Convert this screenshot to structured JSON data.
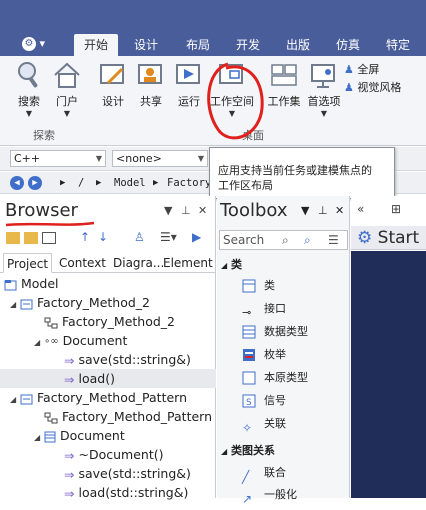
{
  "ribbon_tabs": [
    {
      "label": "开始",
      "active": true
    },
    {
      "label": "设计"
    },
    {
      "label": "布局"
    },
    {
      "label": "开发"
    },
    {
      "label": "出版"
    },
    {
      "label": "仿真"
    },
    {
      "label": "特定"
    }
  ],
  "ribbon": {
    "search": "搜索",
    "portal": "门户",
    "design": "设计",
    "share": "共享",
    "run": "运行",
    "workspace": "工作空间",
    "workset": "工作集",
    "preferences": "首选项",
    "fullscreen": "全屏",
    "visual_style": "视觉风格",
    "group_search": "探索",
    "group_desktop": "桌面"
  },
  "combos": {
    "language": "C++",
    "none": "<none>"
  },
  "breadcrumb": [
    "/",
    "Model",
    "Factory"
  ],
  "tooltip": {
    "line1": "应用支持当前任务或建模焦点的",
    "line2": "工作区布局"
  },
  "browser": {
    "title": "Browser",
    "tabs": [
      "Project",
      "Context",
      "Diagra...",
      "Element"
    ],
    "tree": [
      {
        "label": "Model"
      },
      {
        "label": "Factory_Method_2"
      },
      {
        "label": "Factory_Method_2"
      },
      {
        "label": "Document"
      },
      {
        "label": "save(std::string&)"
      },
      {
        "label": "load()"
      },
      {
        "label": "Factory_Method_Pattern"
      },
      {
        "label": "Factory_Method_Pattern"
      },
      {
        "label": "Document"
      },
      {
        "label": "~Document()"
      },
      {
        "label": "save(std::string&)"
      },
      {
        "label": "load(std::string&)"
      }
    ]
  },
  "toolbox": {
    "title": "Toolbox",
    "search_placeholder": "Search",
    "group1": "类",
    "items": [
      "类",
      "接口",
      "数据类型",
      "枚举",
      "本原类型",
      "信号",
      "关联"
    ],
    "group2": "类图关系",
    "items2": [
      "联合",
      "一般化"
    ]
  },
  "start": {
    "title": "Start P"
  },
  "colors": {
    "ribbon_bar": "#4a5d9b",
    "annotation_red": "#e0201c",
    "start_bg": "#1f2d58"
  }
}
